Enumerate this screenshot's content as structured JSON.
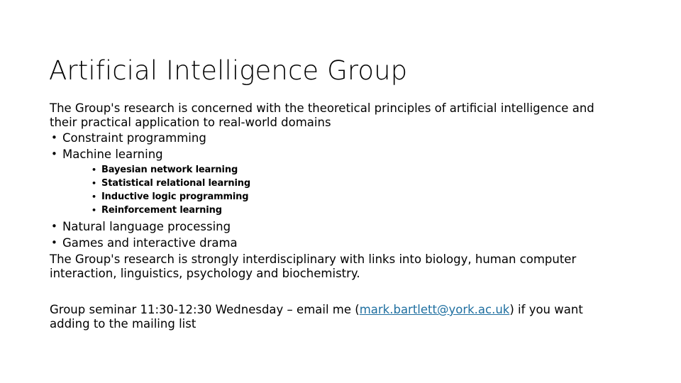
{
  "slide": {
    "title": "Artificial Intelligence Group",
    "intro_paragraph": "The Group's research is concerned with the theoretical principles of artificial intelligence and their practical application to real-world domains",
    "bullet_marker": "•",
    "topics": [
      {
        "label": "Constraint programming",
        "subtopics": []
      },
      {
        "label": "Machine learning",
        "subtopics": [
          "Bayesian network learning",
          "Statistical relational learning",
          "Inductive logic programming",
          "Reinforcement learning"
        ]
      },
      {
        "label": "Natural language processing",
        "subtopics": []
      },
      {
        "label": "Games and interactive drama",
        "subtopics": []
      }
    ],
    "interdisciplinary_paragraph": "The Group's research is strongly interdisciplinary with links into biology, human computer interaction, linguistics, psychology and biochemistry.",
    "seminar": {
      "before_link": "Group seminar 11:30-12:30 Wednesday – email me (",
      "link_text": "mark.bartlett@york.ac.uk",
      "after_link": ") if you want adding to the mailing list",
      "link_color": "#1F6FA0"
    },
    "colors": {
      "background": "#FFFFFF",
      "text": "#000000",
      "link": "#1F6FA0"
    }
  }
}
